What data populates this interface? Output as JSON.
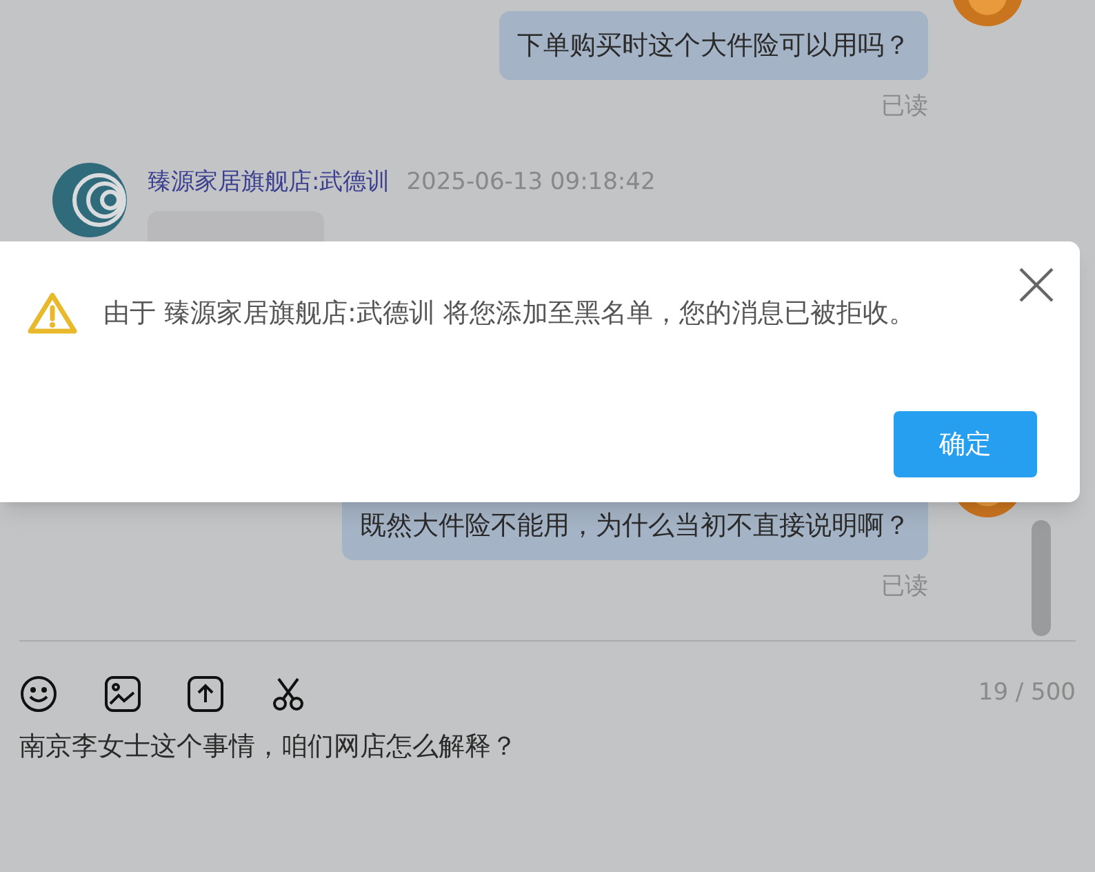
{
  "messages": [
    {
      "kind": "outgoing",
      "text": "下单购买时这个大件险可以用吗？",
      "status": "已读"
    },
    {
      "kind": "incoming",
      "sender": "臻源家居旗舰店:武德训",
      "time": "2025-06-13 09:18:42"
    },
    {
      "kind": "outgoing",
      "text": "既然大件险不能用，为什么当初不直接说明啊？",
      "status": "已读"
    }
  ],
  "dialog": {
    "message": "由于 臻源家居旗舰店:武德训 将您添加至黑名单，您的消息已被拒收。",
    "ok_button": "确定"
  },
  "composer": {
    "counter": "19 / 500",
    "value": "南京李女士这个事情，咱们网店怎么解释？"
  }
}
